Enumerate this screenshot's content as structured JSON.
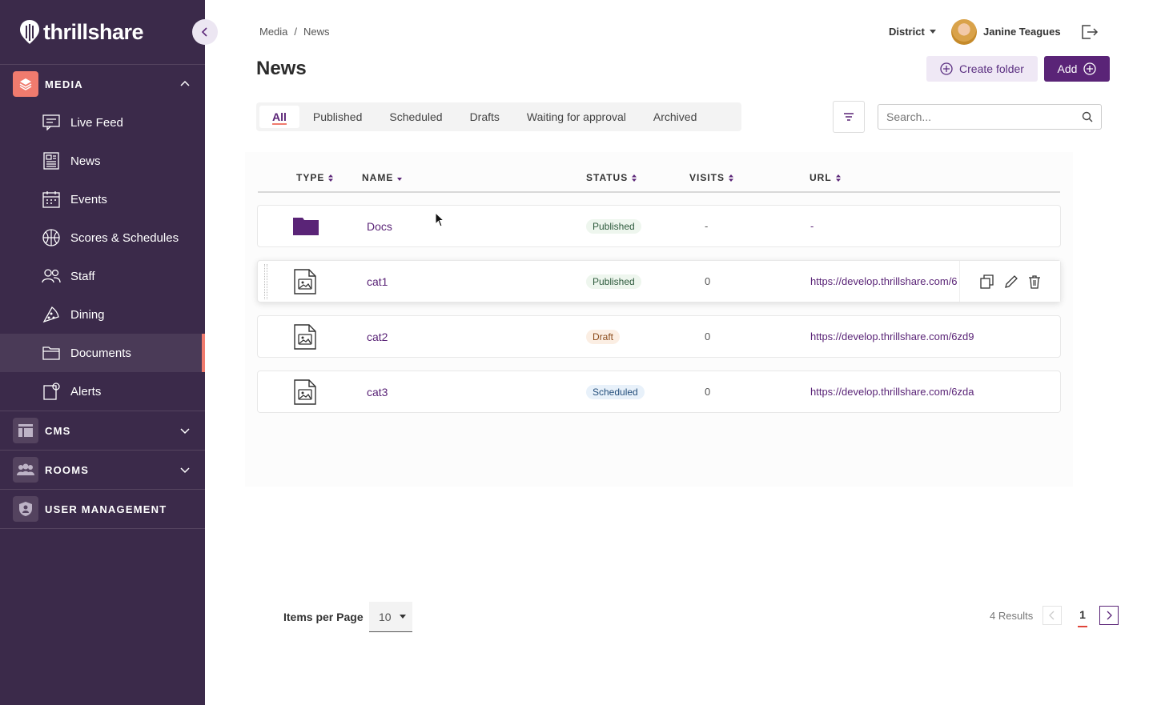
{
  "app": {
    "logo_text": "thrillshare"
  },
  "sidebar": {
    "sections": [
      {
        "label": "MEDIA",
        "expanded": true,
        "icon": "layers-icon",
        "color": "#f07b6e"
      },
      {
        "label": "CMS",
        "expanded": false,
        "icon": "layout-icon"
      },
      {
        "label": "ROOMS",
        "expanded": false,
        "icon": "people-icon"
      },
      {
        "label": "USER MANAGEMENT",
        "icon": "shield-icon"
      }
    ],
    "items": [
      {
        "label": "Live Feed",
        "icon": "live-feed-icon"
      },
      {
        "label": "News",
        "icon": "newspaper-icon"
      },
      {
        "label": "Events",
        "icon": "calendar-icon"
      },
      {
        "label": "Scores & Schedules",
        "icon": "ball-icon"
      },
      {
        "label": "Staff",
        "icon": "staff-icon"
      },
      {
        "label": "Dining",
        "icon": "pizza-icon"
      },
      {
        "label": "Documents",
        "icon": "folder-icon",
        "active": true
      },
      {
        "label": "Alerts",
        "icon": "alert-icon"
      }
    ]
  },
  "header": {
    "breadcrumb": [
      "Media",
      "/",
      "News"
    ],
    "title": "News",
    "district": "District",
    "user_name": "Janine Teagues",
    "create_folder": "Create folder",
    "add": "Add"
  },
  "tabs": [
    {
      "label": "All",
      "active": true
    },
    {
      "label": "Published"
    },
    {
      "label": "Scheduled"
    },
    {
      "label": "Drafts"
    },
    {
      "label": "Waiting for approval"
    },
    {
      "label": "Archived"
    }
  ],
  "search": {
    "placeholder": "Search..."
  },
  "table": {
    "columns": [
      "TYPE",
      "NAME",
      "STATUS",
      "VISITS",
      "URL"
    ],
    "rows": [
      {
        "type": "folder",
        "name": "Docs",
        "status": "Published",
        "visits": "-",
        "url": "-"
      },
      {
        "type": "image",
        "name": "cat1",
        "status": "Published",
        "visits": "0",
        "url": "https://develop.thrillshare.com/6"
      },
      {
        "type": "image",
        "name": "cat2",
        "status": "Draft",
        "visits": "0",
        "url": "https://develop.thrillshare.com/6zd9"
      },
      {
        "type": "image",
        "name": "cat3",
        "status": "Scheduled",
        "visits": "0",
        "url": "https://develop.thrillshare.com/6zda"
      }
    ]
  },
  "pagination": {
    "items_per_page_label": "Items per Page",
    "items_per_page": "10",
    "results": "4 Results",
    "current_page": "1"
  },
  "colors": {
    "sidebar": "#3b2a4a",
    "accent": "#5a2477",
    "highlight": "#f07b6e"
  }
}
